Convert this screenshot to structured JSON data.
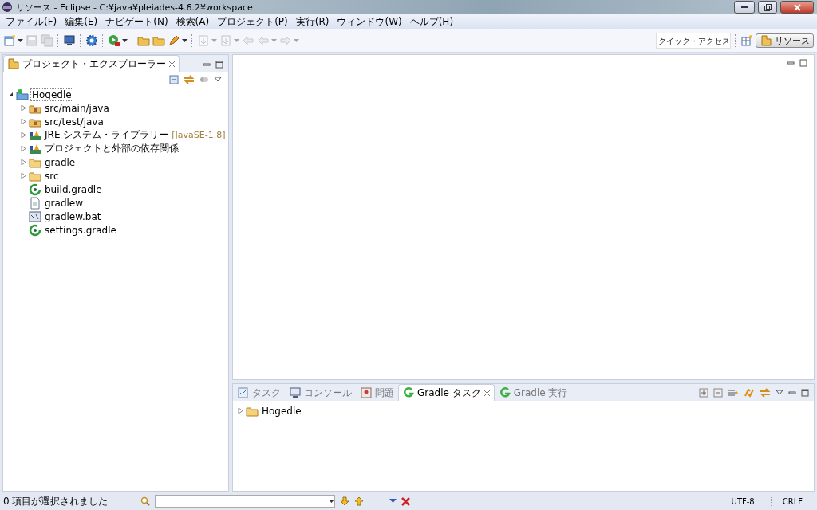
{
  "window": {
    "title": "リソース - Eclipse - C:¥java¥pleiades-4.6.2¥workspace"
  },
  "menu": [
    "ファイル(F)",
    "編集(E)",
    "ナビゲート(N)",
    "検索(A)",
    "プロジェクト(P)",
    "実行(R)",
    "ウィンドウ(W)",
    "ヘルプ(H)"
  ],
  "toolbar": [
    {
      "kind": "new",
      "disabled": false,
      "dropdown": true
    },
    {
      "kind": "save",
      "disabled": true,
      "dropdown": false
    },
    {
      "kind": "save-all",
      "disabled": true,
      "dropdown": false
    },
    {
      "kind": "sep"
    },
    {
      "kind": "monitor",
      "disabled": false,
      "dropdown": false
    },
    {
      "kind": "sep"
    },
    {
      "kind": "gear",
      "disabled": false,
      "dropdown": false
    },
    {
      "kind": "sep"
    },
    {
      "kind": "run",
      "disabled": false,
      "dropdown": true
    },
    {
      "kind": "sep"
    },
    {
      "kind": "folder",
      "disabled": false,
      "dropdown": false
    },
    {
      "kind": "folder",
      "disabled": false,
      "dropdown": false
    },
    {
      "kind": "pen",
      "disabled": false,
      "dropdown": true
    },
    {
      "kind": "sep"
    },
    {
      "kind": "next",
      "disabled": true,
      "dropdown": true
    },
    {
      "kind": "next",
      "disabled": true,
      "dropdown": true
    },
    {
      "kind": "back",
      "disabled": true,
      "dropdown": false
    },
    {
      "kind": "back",
      "disabled": true,
      "dropdown": true
    },
    {
      "kind": "forward",
      "disabled": true,
      "dropdown": true
    }
  ],
  "quick_access": {
    "placeholder": "クイック・アクセス"
  },
  "perspective": {
    "label": "リソース",
    "selected": true
  },
  "explorer": {
    "tab": "プロジェクト・エクスプローラー",
    "tree": [
      {
        "label": "Hogedle",
        "kind": "project",
        "expanded": true,
        "children": [
          {
            "label": "src/main/java",
            "kind": "source",
            "expanded": false
          },
          {
            "label": "src/test/java",
            "kind": "source",
            "expanded": false
          },
          {
            "label": "JRE システム・ライブラリー",
            "note": "[JavaSE-1.8]",
            "kind": "library",
            "expanded": false
          },
          {
            "label": "プロジェクトと外部の依存関係",
            "kind": "library",
            "expanded": false
          },
          {
            "label": "gradle",
            "kind": "folder",
            "expanded": false
          },
          {
            "label": "src",
            "kind": "folder",
            "expanded": false
          },
          {
            "label": "build.gradle",
            "kind": "gradle"
          },
          {
            "label": "gradlew",
            "kind": "file"
          },
          {
            "label": "gradlew.bat",
            "kind": "bat"
          },
          {
            "label": "settings.gradle",
            "kind": "gradle"
          }
        ]
      }
    ]
  },
  "bottom": {
    "tabs": [
      {
        "label": "タスク",
        "kind": "tasks",
        "selected": false
      },
      {
        "label": "コンソール",
        "kind": "console",
        "selected": false
      },
      {
        "label": "問題",
        "kind": "problems",
        "selected": false
      },
      {
        "label": "Gradle タスク",
        "kind": "gradle",
        "selected": true
      },
      {
        "label": "Gradle 実行",
        "kind": "gradle",
        "selected": false
      }
    ],
    "tree": [
      {
        "label": "Hogedle",
        "kind": "folder",
        "expanded": false
      }
    ]
  },
  "status_bar": {
    "message": "0 項目が選択されました",
    "encoding": "UTF-8",
    "line_ending": "CRLF"
  }
}
